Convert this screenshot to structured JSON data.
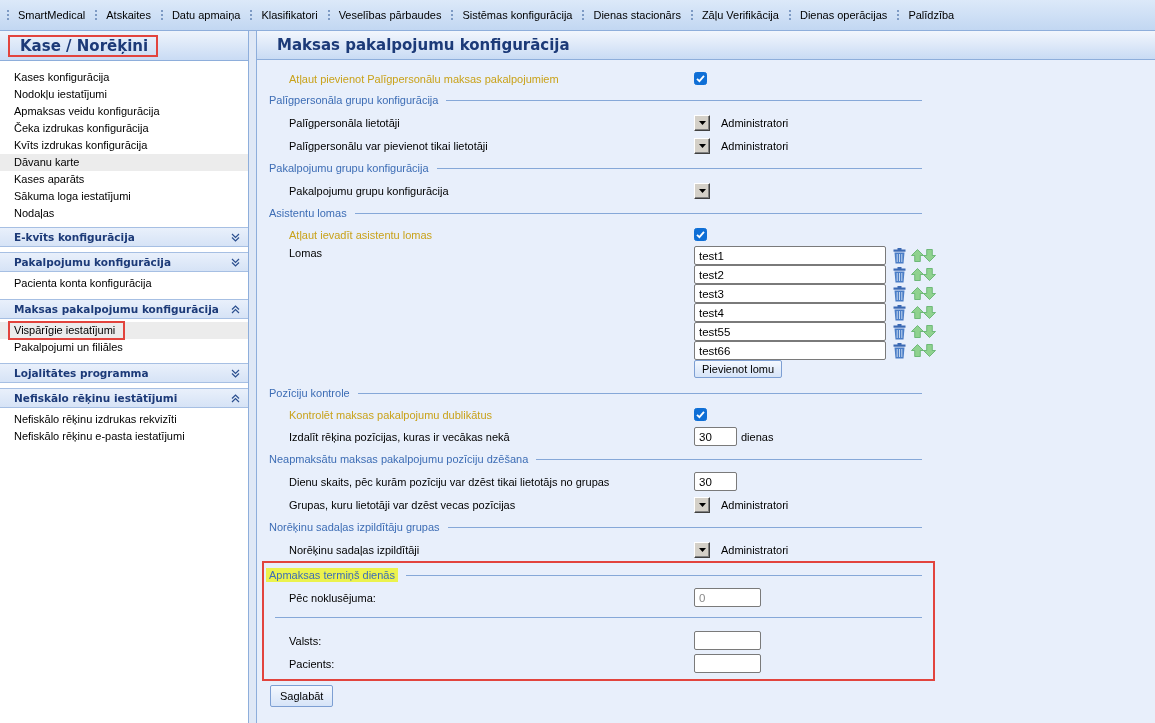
{
  "menu_bar": {
    "items": [
      "SmartMedical",
      "Atskaites",
      "Datu apmaiņa",
      "Klasifikatori",
      "Veselības pārbaudes",
      "Sistēmas konfigurācija",
      "Dienas stacionārs",
      "Zāļu Verifikācija",
      "Dienas operācijas",
      "Palīdzība"
    ]
  },
  "sidebar": {
    "header": {
      "title": "Kase / Norēķini",
      "annotated": true
    },
    "items": [
      {
        "label": "Kases konfigurācija",
        "selected": false,
        "annotated": false
      },
      {
        "label": "Nodokļu iestatījumi",
        "selected": false,
        "annotated": false
      },
      {
        "label": "Apmaksas veidu konfigurācija",
        "selected": false,
        "annotated": false
      },
      {
        "label": "Čeka izdrukas konfigurācija",
        "selected": false,
        "annotated": false
      },
      {
        "label": "Kvīts izdrukas konfigurācija",
        "selected": false,
        "annotated": false
      },
      {
        "label": "Dāvanu karte",
        "selected": true,
        "annotated": false
      },
      {
        "label": "Kases aparāts",
        "selected": false,
        "annotated": false
      },
      {
        "label": "Sākuma loga iestatījumi",
        "selected": false,
        "annotated": false
      },
      {
        "label": "Nodaļas",
        "selected": false,
        "annotated": false
      }
    ],
    "sections": [
      {
        "title": "E-kvīts konfigurācija",
        "expanded": false
      },
      {
        "title": "Pakalpojumu konfigurācija",
        "expanded": false,
        "items": [
          {
            "label": "Pacienta konta konfigurācija",
            "selected": false,
            "annotated": false
          }
        ]
      },
      {
        "title": "Maksas pakalpojumu konfigurācija",
        "expanded": true,
        "items": [
          {
            "label": "Vispārīgie iestatījumi",
            "selected": true,
            "annotated": true
          },
          {
            "label": "Pakalpojumi un filiāles",
            "selected": false,
            "annotated": false
          }
        ]
      },
      {
        "title": "Lojalitātes programma",
        "expanded": false
      },
      {
        "title": "Nefiskālo rēķinu iestātījumi",
        "expanded": true,
        "items": [
          {
            "label": "Nefiskālo rēķinu izdrukas rekvizīti",
            "selected": false,
            "annotated": false
          },
          {
            "label": "Nefiskālo rēķinu e-pasta iestatījumi",
            "selected": false,
            "annotated": false
          }
        ]
      }
    ]
  },
  "main": {
    "title": "Maksas pakalpojumu konfigurācija",
    "rows": [
      {
        "kind": "checkbox",
        "label": "Atļaut pievienot Palīgpersonālu maksas pakalpojumiem",
        "checked": true
      }
    ],
    "sections": [
      {
        "legend": "Palīgpersonāla grupu konfigurācija",
        "annotated": false,
        "rows": [
          {
            "kind": "dropdown",
            "label": "Palīgpersonāla lietotāji",
            "value": "Administratori"
          },
          {
            "kind": "dropdown",
            "label": "Palīgpersonālu var pievienot tikai lietotāji",
            "value": "Administratori"
          }
        ]
      },
      {
        "legend": "Pakalpojumu grupu konfigurācija",
        "annotated": false,
        "rows": [
          {
            "kind": "dropdown",
            "label": "Pakalpojumu grupu konfigurācija"
          }
        ]
      },
      {
        "legend": "Asistentu lomas",
        "annotated": false,
        "rows": [
          {
            "kind": "checkbox",
            "label": "Atļaut ievadīt asistentu lomas",
            "checked": true
          },
          {
            "kind": "list",
            "label": "Lomas",
            "entries": [
              "test1",
              "test2",
              "test3",
              "test4",
              "test55",
              "test66"
            ],
            "add_button": "Pievienot lomu"
          }
        ]
      },
      {
        "legend": "Pozīciju kontrole",
        "annotated": false,
        "rows": [
          {
            "kind": "checkbox",
            "label": "Kontrolēt maksas pakalpojumu dublikātus",
            "checked": true
          },
          {
            "kind": "number",
            "label": "Izdalīt rēķina pozīcijas, kuras ir vecākas nekā",
            "value": "30",
            "unit": "dienas"
          }
        ]
      },
      {
        "legend": "Neapmaksātu maksas pakalpojumu pozīciju dzēšana",
        "annotated": false,
        "rows": [
          {
            "kind": "number",
            "label": "Dienu skaits, pēc kurām pozīciju var dzēst tikai lietotājs no grupas",
            "value": "30"
          },
          {
            "kind": "dropdown",
            "label": "Grupas, kuru lietotāji var dzēst vecas pozīcijas",
            "value": "Administratori"
          }
        ]
      },
      {
        "legend": "Norēķinu sadaļas izpildītāju grupas",
        "annotated": false,
        "rows": [
          {
            "kind": "dropdown",
            "label": "Norēķinu sadaļas izpildītāji",
            "value": "Administratori"
          }
        ]
      },
      {
        "legend": "Apmaksas termiņš dienās",
        "annotated": true,
        "rows": [
          {
            "kind": "text",
            "label": "Pēc noklusējuma:",
            "placeholder": "0"
          },
          {
            "kind": "divider"
          },
          {
            "kind": "text",
            "label": "Valsts:"
          },
          {
            "kind": "text",
            "label": "Pacients:"
          }
        ]
      }
    ],
    "save_button": "Saglabāt"
  }
}
